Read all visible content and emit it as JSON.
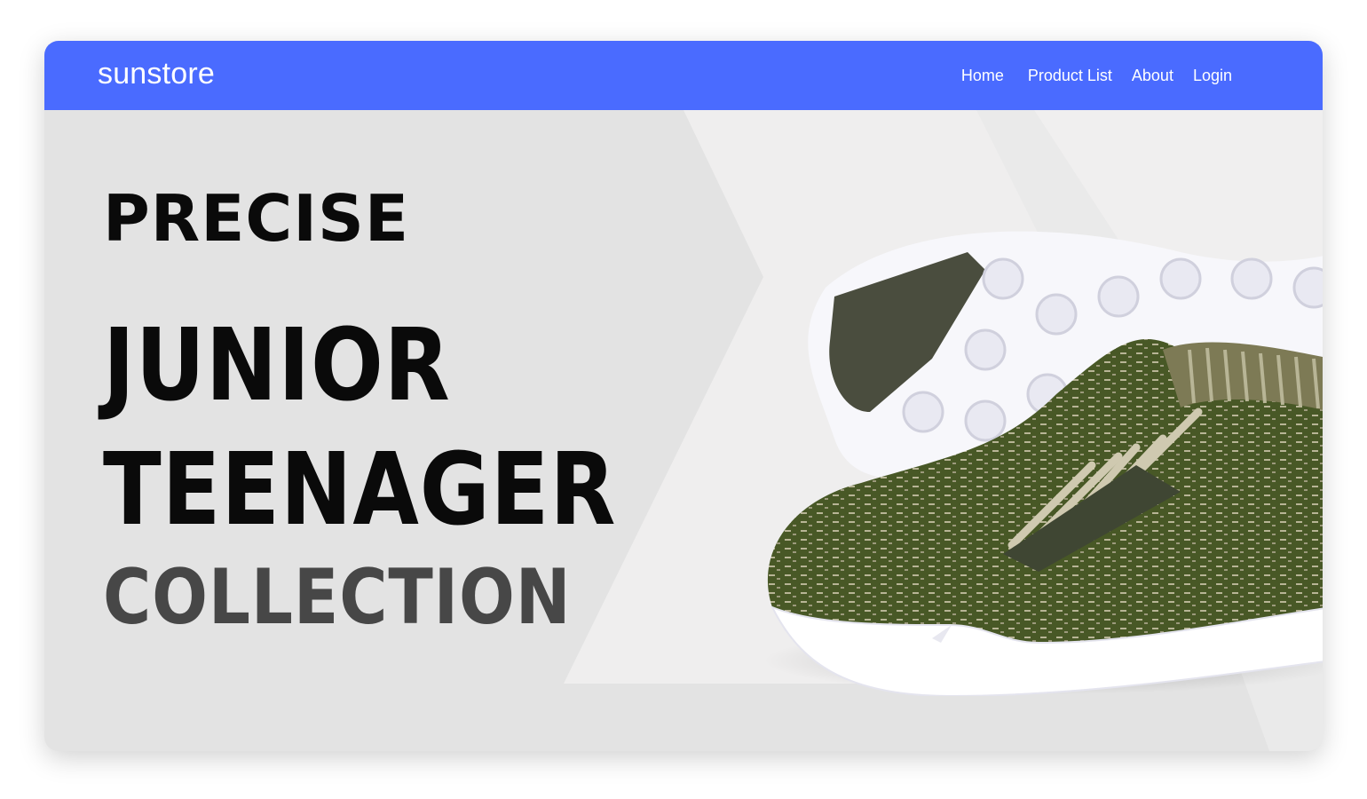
{
  "navbar": {
    "brand": "sunstore",
    "links": [
      "Home",
      "Product List",
      "About",
      "Login"
    ]
  },
  "hero": {
    "line1": "PRECISE",
    "line2": "JUNIOR",
    "line3": "TEENAGER",
    "line4": "COLLECTION",
    "image": "green-knit-sneaker-image"
  },
  "colors": {
    "navbar": "#4a6bff",
    "hero_bg": "#e3e3e3",
    "chevron": "#efeeee",
    "shoe_knit": "#4a5a2c",
    "shoe_sole": "#ffffff"
  }
}
